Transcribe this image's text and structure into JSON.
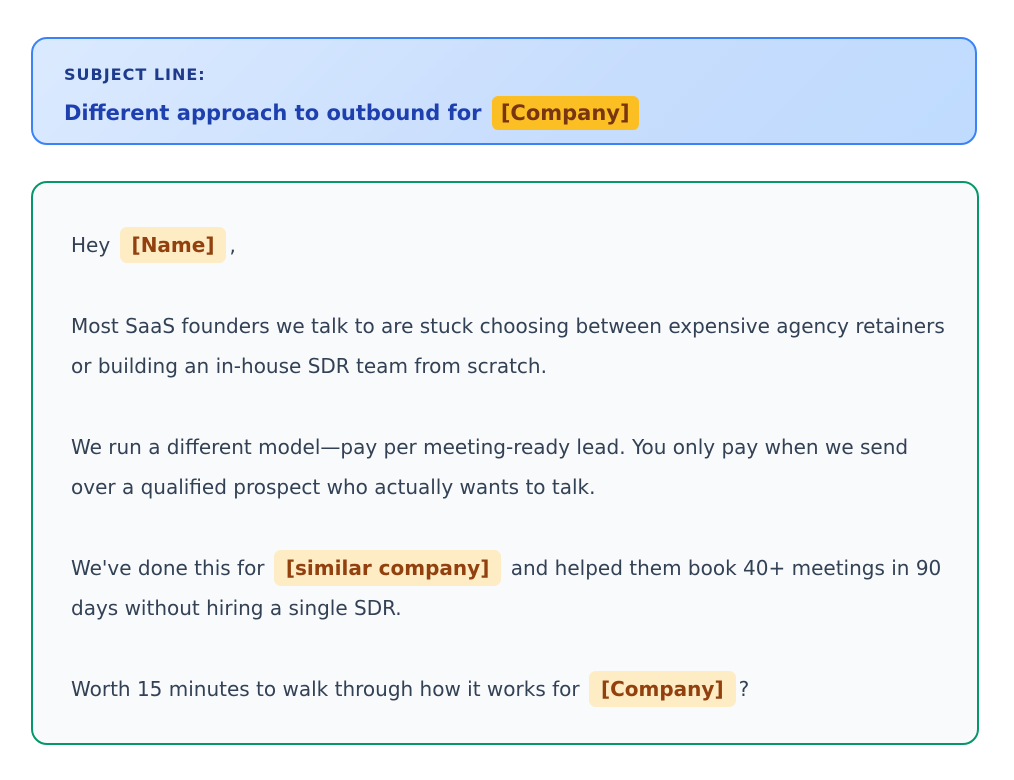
{
  "subject": {
    "label": "SUBJECT LINE:",
    "text": "Different approach to outbound for",
    "token": "[Company]"
  },
  "email": {
    "greeting": {
      "prefix": "Hey",
      "token": "[Name]",
      "suffix": ","
    },
    "paragraph1": {
      "line1": "Most SaaS founders we talk to are stuck choosing between expensive agency retainers",
      "line2": "or building an in-house SDR team from scratch."
    },
    "paragraph2": {
      "line1": "We run a different model—pay per meeting-ready lead. You only pay when we send",
      "line2": "over a qualified prospect who actually wants to talk."
    },
    "paragraph3": {
      "line1_prefix": "We've done this for",
      "token": "[similar company]",
      "line1_suffix": "and helped them book 40+ meetings in 90",
      "line2": "days without hiring a single SDR."
    },
    "paragraph4": {
      "prefix": "Worth 15 minutes to walk through how it works for",
      "token": "[Company]",
      "suffix": "?"
    }
  }
}
